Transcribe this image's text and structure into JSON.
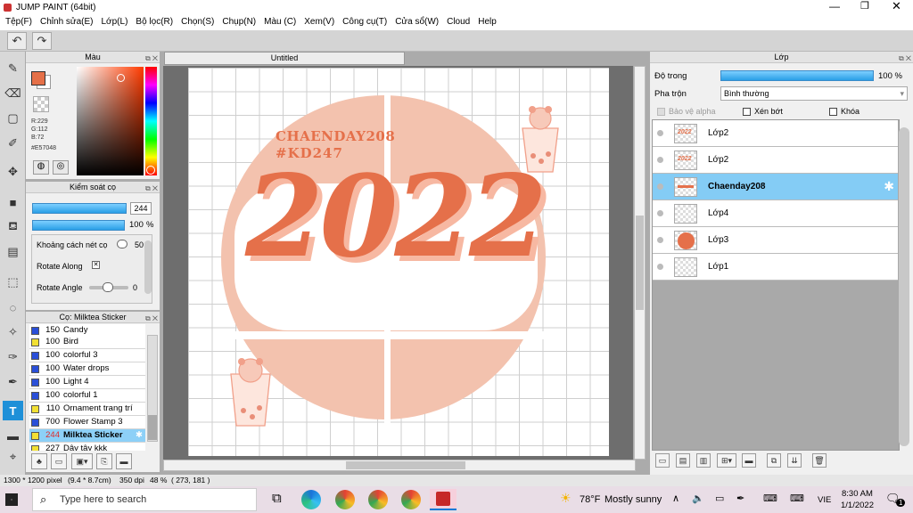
{
  "app": {
    "title": "JUMP PAINT (64bit)"
  },
  "menu": [
    "Tệp(F)",
    "Chỉnh sửa(E)",
    "Lớp(L)",
    "Bộ lọc(R)",
    "Chọn(S)",
    "Chụp(N)",
    "Màu (C)",
    "Xem(V)",
    "Công cụ(T)",
    "Cửa sổ(W)",
    "Cloud",
    "Help"
  ],
  "color_panel": {
    "title": "Màu",
    "r": "R:229",
    "g": "G:112",
    "b": "B:72",
    "hex": "#E57048",
    "fg": "#E57048"
  },
  "brush_control": {
    "title": "Kiểm soát cọ",
    "size": "244",
    "opacity": "100",
    "opacity_unit": "%",
    "spacing_label": "Khoảng cách nét cọ",
    "spacing_value": "50",
    "rotate_along_label": "Rotate Along",
    "rotate_angle_label": "Rotate Angle",
    "rotate_angle_value": "0"
  },
  "brush_list": {
    "title": "Cọ: Milktea Sticker",
    "items": [
      {
        "size": "150",
        "name": "Candy",
        "color": "#2a4fd8"
      },
      {
        "size": "100",
        "name": "Bird",
        "color": "#f2e033"
      },
      {
        "size": "100",
        "name": "colorful 3",
        "color": "#2a4fd8"
      },
      {
        "size": "100",
        "name": "Water drops",
        "color": "#2a4fd8"
      },
      {
        "size": "100",
        "name": "Light 4",
        "color": "#2a4fd8"
      },
      {
        "size": "100",
        "name": "colorful 1",
        "color": "#2a4fd8"
      },
      {
        "size": "110",
        "name": "Ornament trang trí",
        "color": "#f2e033"
      },
      {
        "size": "700",
        "name": "Flower Stamp 3",
        "color": "#2a4fd8"
      },
      {
        "size": "244",
        "name": "Milktea Sticker",
        "color": "#f2e033"
      },
      {
        "size": "227",
        "name": "Dây tây kkk",
        "color": "#f2e033"
      }
    ]
  },
  "canvas": {
    "tab": "Untitled",
    "text1": "CHAENDAY208",
    "text2": "#KD247",
    "year": "2022",
    "bg_circle": "#f3c2ae",
    "lettering": "#e5704a"
  },
  "layer_panel": {
    "title": "Lớp",
    "opacity_label": "Độ trong",
    "opacity_value": "100 %",
    "blend_label": "Pha trộn",
    "blend_value": "Bình thường",
    "protect_alpha": "Bảo vệ alpha",
    "clip": "Xén bớt",
    "lock": "Khóa",
    "layers": [
      {
        "name": "Lớp2",
        "thumb": "2022"
      },
      {
        "name": "Lớp2",
        "thumb": "2022"
      },
      {
        "name": "Chaenday208",
        "thumb": "text",
        "selected": true
      },
      {
        "name": "Lớp4",
        "thumb": "blank"
      },
      {
        "name": "Lớp3",
        "thumb": "circle"
      },
      {
        "name": "Lớp1",
        "thumb": "blank"
      }
    ]
  },
  "status": {
    "size": "1300 * 1200 pixel",
    "dims": "(9.4 * 8.7cm)",
    "dpi": "350 dpi",
    "zoom": "48 %",
    "coords": "( 273, 181 )"
  },
  "taskbar": {
    "search_placeholder": "Type here to search",
    "weather_temp": "78°F",
    "weather_desc": "Mostly sunny",
    "lang": "VIE",
    "time": "8:30 AM",
    "date": "1/1/2022",
    "notif": "1"
  }
}
